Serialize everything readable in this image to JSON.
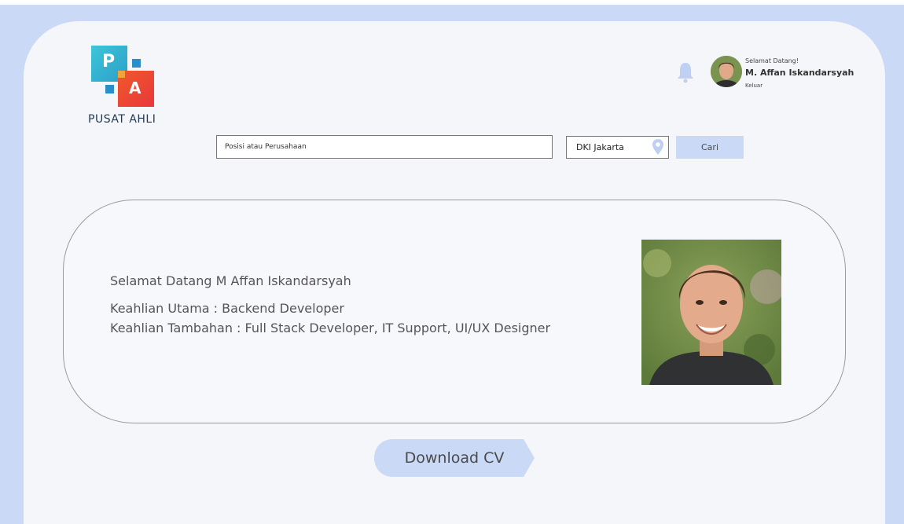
{
  "app": {
    "logo_letter_top": "P",
    "logo_letter_bottom": "A",
    "logo_text": "PUSAT AHLI"
  },
  "header": {
    "greeting": "Selamat Datang!",
    "user_name": "M. Affan Iskandarsyah",
    "logout_label": "Keluar",
    "icons": [
      "bell-icon",
      "avatar"
    ]
  },
  "search": {
    "query_placeholder": "Posisi atau Perusahaan",
    "location_value": "DKI Jakarta",
    "button_label": "Cari"
  },
  "profile": {
    "welcome": "Selamat Datang M Affan Iskandarsyah",
    "main_skill": "Keahlian Utama : Backend Developer",
    "extra_skills": "Keahlian Tambahan : Full Stack Developer, IT Support, UI/UX Designer"
  },
  "actions": {
    "download_cv_label": "Download CV"
  },
  "colors": {
    "background": "#cad9f6",
    "panel": "#f5f6fa",
    "accent": "#cad9f6"
  }
}
